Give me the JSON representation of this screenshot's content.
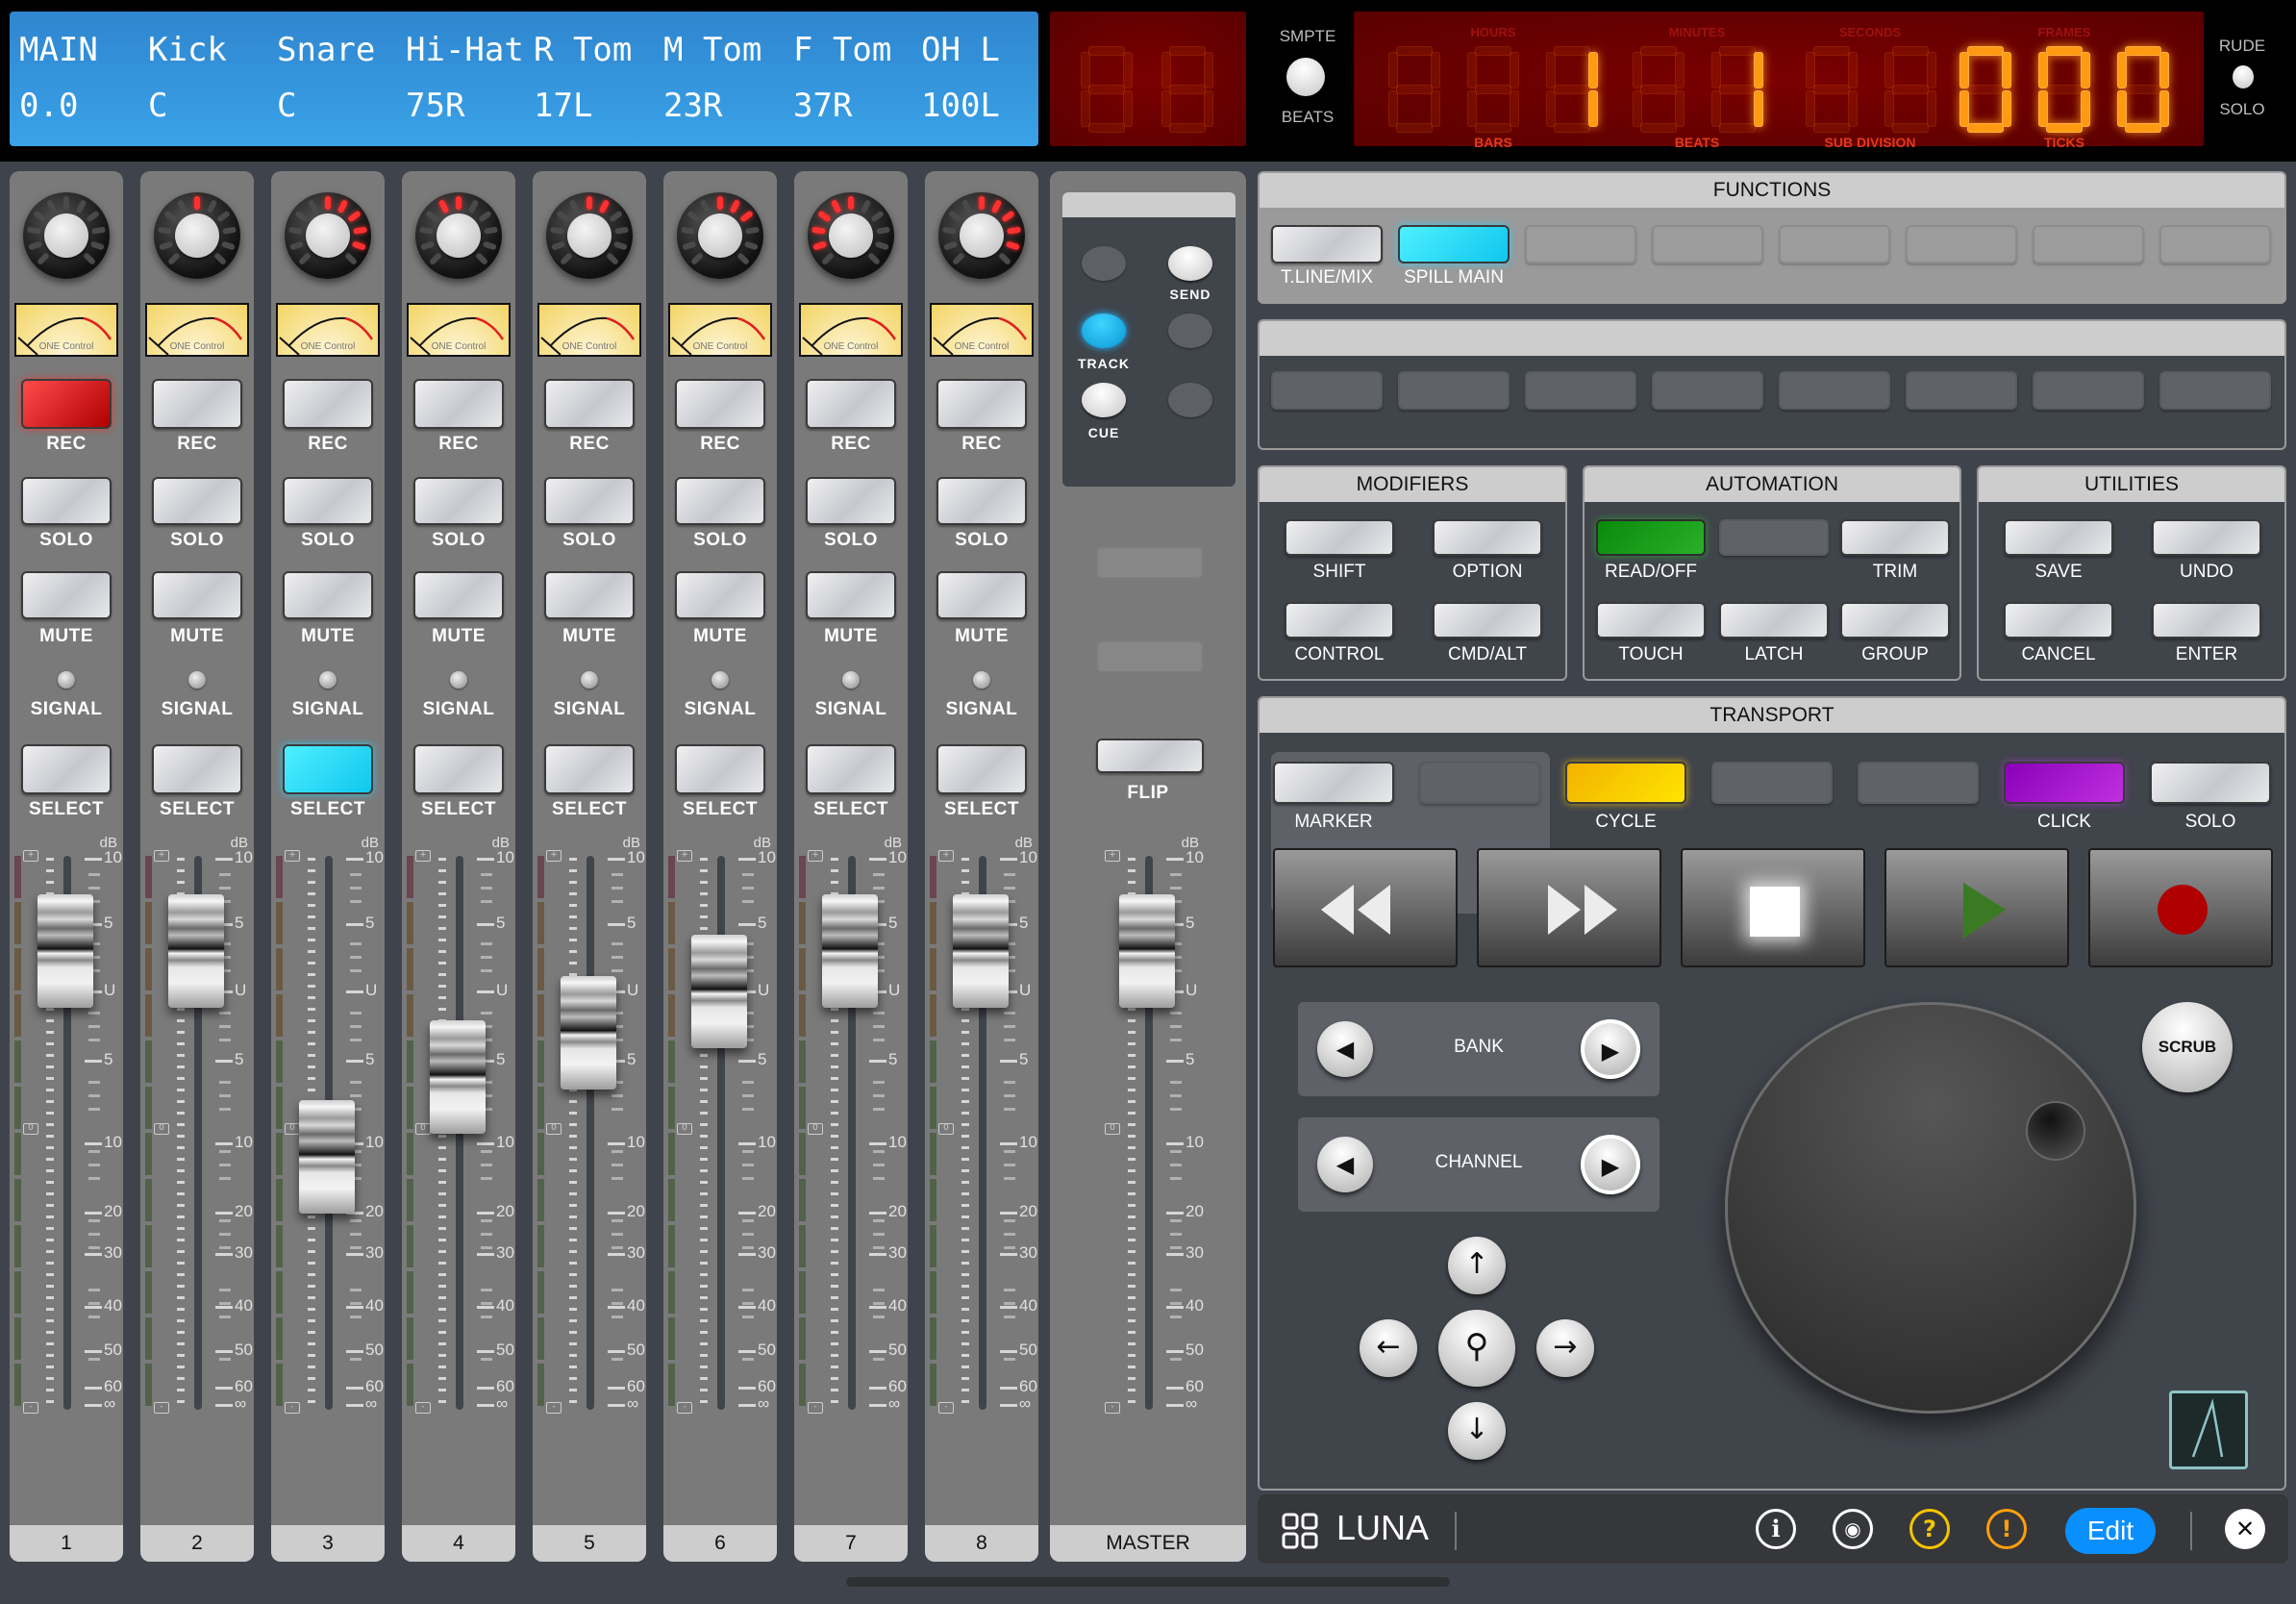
{
  "lcd": {
    "names": [
      "MAIN",
      "Kick",
      "Snare",
      "Hi-Hat",
      "R Tom",
      "M Tom",
      "F Tom",
      "OH L"
    ],
    "values": [
      "0.0",
      "C",
      "C",
      "75R",
      "17L",
      "23R",
      "37R",
      "100L"
    ]
  },
  "display_mode": {
    "top_label": "SMPTE",
    "bottom_label": "BEATS"
  },
  "timecode": {
    "top_labels": [
      "HOURS",
      "MINUTES",
      "SECONDS",
      "FRAMES"
    ],
    "bottom_labels": [
      "BARS",
      "BEATS",
      "SUB DIVISION",
      "TICKS"
    ],
    "bars": "  1",
    "beats": " 1",
    "sub_division": "  ",
    "ticks": "000"
  },
  "rude_solo": {
    "top_label": "RUDE",
    "bottom_label": "SOLO"
  },
  "channels": [
    {
      "number": "1",
      "pan_leds": [],
      "rec": "active",
      "select": "off",
      "fader_db": "+3"
    },
    {
      "number": "2",
      "pan_leds": [
        0
      ],
      "rec": "off",
      "select": "off",
      "fader_db": "+3"
    },
    {
      "number": "3",
      "pan_leds": [
        0,
        1,
        2,
        3,
        4
      ],
      "rec": "off",
      "select": "active",
      "fader_db": "-12"
    },
    {
      "number": "4",
      "pan_leds": [
        -1,
        0
      ],
      "rec": "off",
      "select": "off",
      "fader_db": "-6"
    },
    {
      "number": "5",
      "pan_leds": [
        0,
        1
      ],
      "rec": "off",
      "select": "off",
      "fader_db": "-3"
    },
    {
      "number": "6",
      "pan_leds": [
        0,
        1,
        2
      ],
      "rec": "off",
      "select": "off",
      "fader_db": "0"
    },
    {
      "number": "7",
      "pan_leds": [
        -4,
        -3,
        -2,
        -1,
        0
      ],
      "rec": "off",
      "select": "off",
      "fader_db": "+3"
    },
    {
      "number": "8",
      "pan_leds": [
        0,
        1,
        2,
        3,
        4
      ],
      "rec": "off",
      "select": "off",
      "fader_db": "+3"
    }
  ],
  "strip_labels": {
    "rec": "REC",
    "solo": "SOLO",
    "mute": "MUTE",
    "signal": "SIGNAL",
    "select": "SELECT",
    "db": "dB",
    "vu_brand": "ONE Control"
  },
  "fader_scale": [
    "10",
    "5",
    "U",
    "5",
    "10",
    "20",
    "30",
    "40",
    "50",
    "60",
    "∞"
  ],
  "master": {
    "label": "MASTER",
    "send_label": "SEND",
    "track_label": "TRACK",
    "cue_label": "CUE",
    "flip_label": "FLIP",
    "fader_db": "+3"
  },
  "functions": {
    "title": "FUNCTIONS",
    "buttons": [
      {
        "label": "T.LINE/MIX",
        "state": "on"
      },
      {
        "label": "SPILL MAIN",
        "state": "active"
      },
      {
        "label": "",
        "state": "blank"
      },
      {
        "label": "",
        "state": "blank"
      },
      {
        "label": "",
        "state": "blank"
      },
      {
        "label": "",
        "state": "blank"
      },
      {
        "label": "",
        "state": "blank"
      },
      {
        "label": "",
        "state": "blank"
      }
    ]
  },
  "modifiers": {
    "title": "MODIFIERS",
    "buttons": [
      "SHIFT",
      "OPTION",
      "CONTROL",
      "CMD/ALT"
    ]
  },
  "automation": {
    "title": "AUTOMATION",
    "buttons": [
      "READ/OFF",
      "",
      "TRIM",
      "TOUCH",
      "LATCH",
      "GROUP"
    ]
  },
  "utilities": {
    "title": "UTILITIES",
    "buttons": [
      "SAVE",
      "UNDO",
      "CANCEL",
      "ENTER"
    ]
  },
  "transport": {
    "title": "TRANSPORT",
    "top_buttons": [
      {
        "label": "MARKER",
        "state": "on"
      },
      {
        "label": "",
        "state": "dim"
      },
      {
        "label": "CYCLE",
        "state": "yellow"
      },
      {
        "label": "",
        "state": "dim"
      },
      {
        "label": "",
        "state": "dim"
      },
      {
        "label": "CLICK",
        "state": "purple"
      },
      {
        "label": "SOLO",
        "state": "on"
      }
    ],
    "controls": [
      "rewind",
      "fast-forward",
      "stop",
      "play",
      "record"
    ]
  },
  "nav": {
    "bank_label": "BANK",
    "channel_label": "CHANNEL",
    "scrub_label": "SCRUB"
  },
  "footer": {
    "app_name": "LUNA",
    "edit_label": "Edit"
  },
  "colors": {
    "lcd_blue": "#3aa2e8",
    "rec_red": "#d01010",
    "select_cyan": "#22d8f8",
    "read_green": "#1a9a1a",
    "cycle_yellow": "#ffd000",
    "click_purple": "#a020d0",
    "edit_blue": "#0a84ff"
  }
}
